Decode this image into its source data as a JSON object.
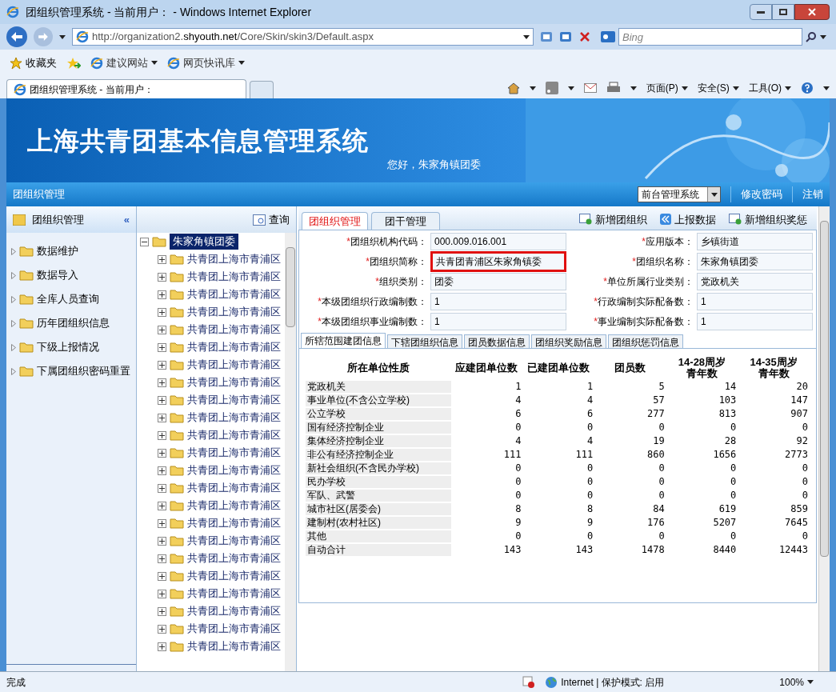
{
  "window": {
    "title": "团组织管理系统 - 当前用户： - Windows Internet Explorer"
  },
  "address": {
    "url_prefix": "http://organization2.",
    "url_domain": "shyouth.net",
    "url_suffix": "/Core/Skin/skin3/Default.aspx"
  },
  "search": {
    "placeholder": "Bing"
  },
  "favorites_bar": {
    "favorites": "收藏夹",
    "links": [
      "建议网站",
      "网页快讯库"
    ]
  },
  "browser_tab": {
    "title": "团组织管理系统 - 当前用户："
  },
  "command_bar": [
    "页面(P)",
    "安全(S)",
    "工具(O)"
  ],
  "banner": {
    "title": "上海共青团基本信息管理系统",
    "greeting": "您好，朱家角镇团委"
  },
  "nav": {
    "section": "团组织管理",
    "select": "前台管理系统",
    "links": [
      "修改密码",
      "注销"
    ]
  },
  "sidebar": {
    "title": "团组织管理",
    "collapse": "«",
    "items": [
      "数据维护",
      "数据导入",
      "全库人员查询",
      "历年团组织信息",
      "下级上报情况",
      "下属团组织密码重置"
    ]
  },
  "tree": {
    "query": "查询",
    "root": {
      "label": "朱家角镇团委",
      "expanded": true,
      "selected": true,
      "children": [
        {
          "label": "共青团上海市青浦区",
          "expanded": false
        },
        {
          "label": "共青团上海市青浦区",
          "expanded": false
        },
        {
          "label": "共青团上海市青浦区",
          "expanded": false
        },
        {
          "label": "共青团上海市青浦区",
          "expanded": false
        },
        {
          "label": "共青团上海市青浦区",
          "expanded": false
        },
        {
          "label": "共青团上海市青浦区",
          "expanded": false
        },
        {
          "label": "共青团上海市青浦区",
          "expanded": false
        },
        {
          "label": "共青团上海市青浦区",
          "expanded": false
        },
        {
          "label": "共青团上海市青浦区",
          "expanded": false
        },
        {
          "label": "共青团上海市青浦区",
          "expanded": false
        },
        {
          "label": "共青团上海市青浦区",
          "expanded": false
        },
        {
          "label": "共青团上海市青浦区",
          "expanded": false
        },
        {
          "label": "共青团上海市青浦区",
          "expanded": false
        },
        {
          "label": "共青团上海市青浦区",
          "expanded": false
        },
        {
          "label": "共青团上海市青浦区",
          "expanded": false
        },
        {
          "label": "共青团上海市青浦区",
          "expanded": false
        },
        {
          "label": "共青团上海市青浦区",
          "expanded": false
        },
        {
          "label": "共青团上海市青浦区",
          "expanded": false
        },
        {
          "label": "共青团上海市青浦区",
          "expanded": false
        },
        {
          "label": "共青团上海市青浦区",
          "expanded": false
        },
        {
          "label": "共青团上海市青浦区",
          "expanded": false
        },
        {
          "label": "共青团上海市青浦区",
          "expanded": false
        },
        {
          "label": "共青团上海市青浦区",
          "expanded": false
        }
      ]
    }
  },
  "content_tabs": [
    {
      "label": "团组织管理",
      "selected": true
    },
    {
      "label": "团干管理",
      "selected": false
    }
  ],
  "actions": [
    {
      "label": "新增团组织",
      "kind": "add"
    },
    {
      "label": "上报数据",
      "kind": "report"
    },
    {
      "label": "新增组织奖惩",
      "kind": "add"
    }
  ],
  "form": [
    {
      "mark": "*",
      "label": "团组织机构代码：",
      "value": "000.009.016.001",
      "highlighted": false
    },
    {
      "mark": "*",
      "label": "应用版本：",
      "value": "乡镇街道",
      "highlighted": false
    },
    {
      "mark": "*",
      "label": "团组织简称：",
      "value": "共青团青浦区朱家角镇委",
      "highlighted": true
    },
    {
      "mark": "*",
      "label": "团组织名称：",
      "value": "朱家角镇团委",
      "highlighted": false
    },
    {
      "mark": "*",
      "label": "组织类别：",
      "value": "团委",
      "highlighted": false
    },
    {
      "mark": "*",
      "label": "单位所属行业类别：",
      "value": "党政机关",
      "highlighted": false
    },
    {
      "mark": "*",
      "label": "本级团组织行政编制数：",
      "value": "1",
      "highlighted": false
    },
    {
      "mark": "*",
      "label": "行政编制实际配备数：",
      "value": "1",
      "highlighted": false
    },
    {
      "mark": "*",
      "label": "本级团组织事业编制数：",
      "value": "1",
      "highlighted": false
    },
    {
      "mark": "*",
      "label": "事业编制实际配备数：",
      "value": "1",
      "highlighted": false
    }
  ],
  "sub_tabs": [
    {
      "label": "所辖范围建团信息",
      "selected": true
    },
    {
      "label": "下辖团组织信息",
      "selected": false
    },
    {
      "label": "团员数据信息",
      "selected": false
    },
    {
      "label": "团组织奖励信息",
      "selected": false
    },
    {
      "label": "团组织惩罚信息",
      "selected": false
    }
  ],
  "table": {
    "columns": [
      "所在单位性质",
      "应建团单位数",
      "已建团单位数",
      "团员数",
      "14-28周岁青年数",
      "14-35周岁青年数"
    ],
    "rows": [
      [
        "党政机关",
        "1",
        "1",
        "5",
        "14",
        "20"
      ],
      [
        "事业单位(不含公立学校)",
        "4",
        "4",
        "57",
        "103",
        "147"
      ],
      [
        "公立学校",
        "6",
        "6",
        "277",
        "813",
        "907"
      ],
      [
        "国有经济控制企业",
        "0",
        "0",
        "0",
        "0",
        "0"
      ],
      [
        "集体经济控制企业",
        "4",
        "4",
        "19",
        "28",
        "92"
      ],
      [
        "非公有经济控制企业",
        "111",
        "111",
        "860",
        "1656",
        "2773"
      ],
      [
        "新社会组织(不含民办学校)",
        "0",
        "0",
        "0",
        "0",
        "0"
      ],
      [
        "民办学校",
        "0",
        "0",
        "0",
        "0",
        "0"
      ],
      [
        "军队、武警",
        "0",
        "0",
        "0",
        "0",
        "0"
      ],
      [
        "城市社区(居委会)",
        "8",
        "8",
        "84",
        "619",
        "859"
      ],
      [
        "建制村(农村社区)",
        "9",
        "9",
        "176",
        "5207",
        "7645"
      ],
      [
        "其他",
        "0",
        "0",
        "0",
        "0",
        "0"
      ],
      [
        "自动合计",
        "143",
        "143",
        "1478",
        "8440",
        "12443"
      ]
    ]
  },
  "status_bar": {
    "text": "完成",
    "zone": "Internet | 保护模式: 启用",
    "zoom": "100%"
  }
}
